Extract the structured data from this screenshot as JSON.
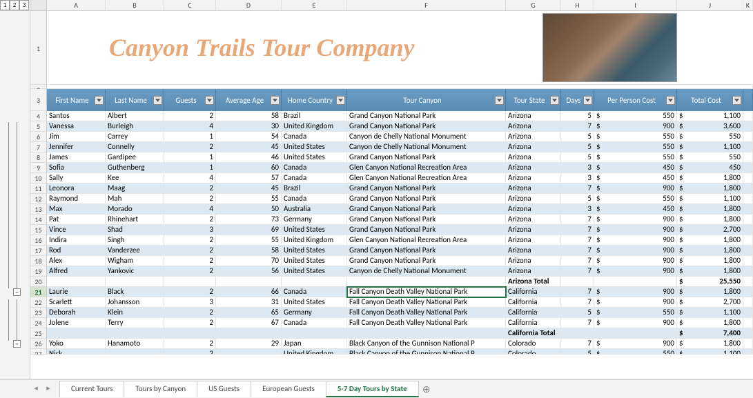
{
  "title": "Canyon Trails Tour Company",
  "outline_levels": [
    "1",
    "2",
    "3"
  ],
  "col_letters": [
    "A",
    "B",
    "C",
    "D",
    "E",
    "F",
    "G",
    "H",
    "I",
    "J",
    "K"
  ],
  "headers": [
    "First Name",
    "Last Name",
    "Guests",
    "Average Age",
    "Home Country",
    "Tour Canyon",
    "Tour State",
    "Days",
    "Per Person Cost",
    "Total Cost"
  ],
  "active_tab": "5-7 Day Tours by State",
  "tabs": [
    "Current Tours",
    "Tours by Canyon",
    "US Guests",
    "European Guests",
    "5-7 Day Tours by State"
  ],
  "subtotals": {
    "20": {
      "label": "Arizona Total",
      "total": "25,550"
    },
    "25": {
      "label": "California Total",
      "total": "7,400"
    }
  },
  "chart_data": {
    "type": "table",
    "columns": [
      "Row",
      "First Name",
      "Last Name",
      "Guests",
      "Average Age",
      "Home Country",
      "Tour Canyon",
      "Tour State",
      "Days",
      "Per Person Cost",
      "Total Cost"
    ],
    "rows": [
      [
        4,
        "Santos",
        "Albert",
        2,
        58,
        "Brazil",
        "Grand Canyon National Park",
        "Arizona",
        5,
        550,
        1100
      ],
      [
        5,
        "Vanessa",
        "Burleigh",
        4,
        30,
        "United Kingdom",
        "Grand Canyon National Park",
        "Arizona",
        7,
        900,
        3600
      ],
      [
        6,
        "Jim",
        "Carrey",
        1,
        54,
        "Canada",
        "Canyon de Chelly National Monument",
        "Arizona",
        5,
        550,
        550
      ],
      [
        7,
        "Jennifer",
        "Connelly",
        2,
        45,
        "United States",
        "Canyon de Chelly National Monument",
        "Arizona",
        5,
        550,
        1100
      ],
      [
        8,
        "James",
        "Gardipee",
        1,
        46,
        "United States",
        "Grand Canyon National Park",
        "Arizona",
        5,
        550,
        550
      ],
      [
        9,
        "Sofia",
        "Guthenberg",
        1,
        60,
        "Canada",
        "Glen Canyon National Recreation Area",
        "Arizona",
        3,
        450,
        450
      ],
      [
        10,
        "Sally",
        "Kee",
        4,
        57,
        "Canada",
        "Glen Canyon National Recreation Area",
        "Arizona",
        3,
        450,
        1800
      ],
      [
        11,
        "Leonora",
        "Maag",
        2,
        45,
        "Brazil",
        "Grand Canyon National Park",
        "Arizona",
        7,
        900,
        1800
      ],
      [
        12,
        "Raymond",
        "Mah",
        2,
        55,
        "Canada",
        "Grand Canyon National Park",
        "Arizona",
        5,
        550,
        1100
      ],
      [
        13,
        "Max",
        "Morado",
        4,
        50,
        "Australia",
        "Grand Canyon National Park",
        "Arizona",
        3,
        450,
        1800
      ],
      [
        14,
        "Pat",
        "Rhinehart",
        2,
        73,
        "Germany",
        "Grand Canyon National Park",
        "Arizona",
        7,
        900,
        1800
      ],
      [
        15,
        "Vince",
        "Shad",
        3,
        69,
        "United States",
        "Grand Canyon National Park",
        "Arizona",
        7,
        900,
        2700
      ],
      [
        16,
        "Indira",
        "Singh",
        2,
        55,
        "United Kingdom",
        "Glen Canyon National Recreation Area",
        "Arizona",
        7,
        900,
        1800
      ],
      [
        17,
        "Rod",
        "Vanderzee",
        2,
        58,
        "United States",
        "Grand Canyon National Park",
        "Arizona",
        7,
        900,
        1800
      ],
      [
        18,
        "Alex",
        "Wigham",
        2,
        70,
        "United States",
        "Grand Canyon National Park",
        "Arizona",
        7,
        900,
        1800
      ],
      [
        19,
        "Alfred",
        "Yankovic",
        2,
        56,
        "United States",
        "Canyon de Chelly National Monument",
        "Arizona",
        7,
        900,
        1800
      ],
      [
        21,
        "Laurie",
        "Black",
        2,
        66,
        "Canada",
        "Fall Canyon Death Valley National Park",
        "California",
        7,
        900,
        1800
      ],
      [
        22,
        "Scarlett",
        "Johansson",
        3,
        31,
        "United States",
        "Fall Canyon Death Valley National Park",
        "California",
        7,
        900,
        2700
      ],
      [
        23,
        "Deborah",
        "Klein",
        2,
        65,
        "Germany",
        "Fall Canyon Death Valley National Park",
        "California",
        5,
        550,
        1100
      ],
      [
        24,
        "Jolene",
        "Terry",
        2,
        67,
        "Canada",
        "Fall Canyon Death Valley National Park",
        "California",
        7,
        900,
        1800
      ],
      [
        26,
        "Yoko",
        "Hanamoto",
        2,
        29,
        "Japan",
        "Black Canyon of the Gunnison National P",
        "Colorado",
        7,
        900,
        1800
      ]
    ]
  }
}
